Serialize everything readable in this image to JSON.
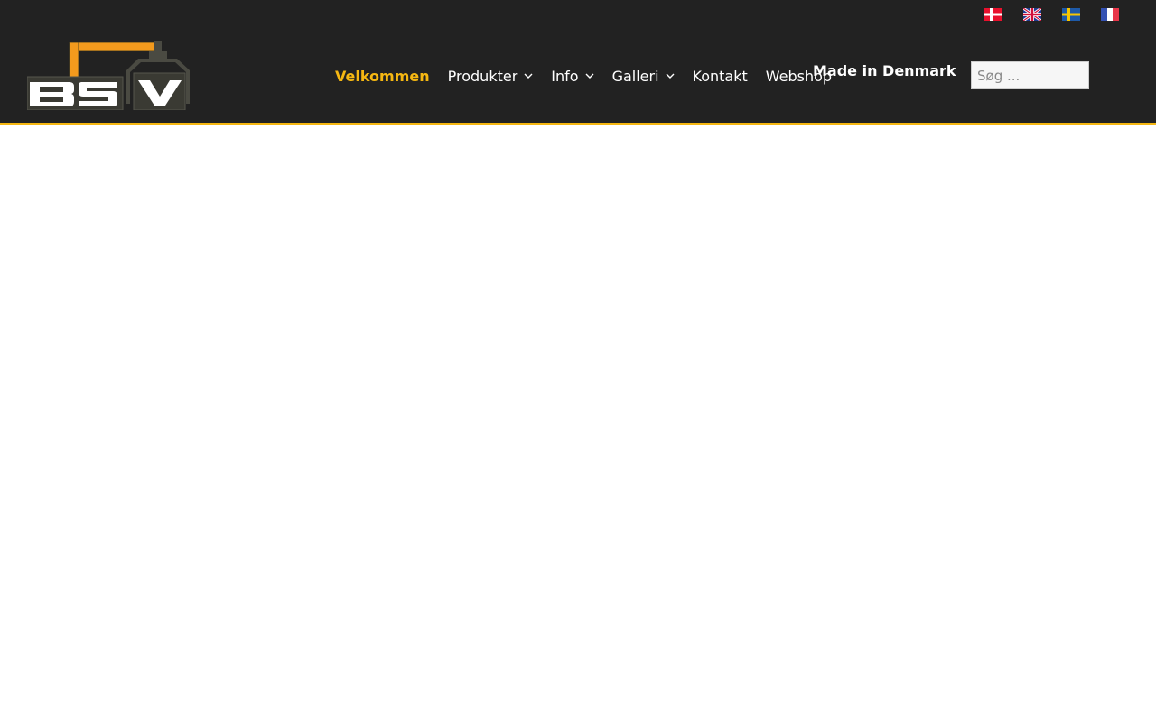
{
  "languages": [
    {
      "code": "da",
      "icon": "denmark-flag-icon"
    },
    {
      "code": "en",
      "icon": "uk-flag-icon"
    },
    {
      "code": "sv",
      "icon": "sweden-flag-icon"
    },
    {
      "code": "fr",
      "icon": "france-flag-icon"
    }
  ],
  "logo": {
    "text": "BSV"
  },
  "nav": {
    "items": [
      {
        "label": "Velkommen",
        "active": true
      },
      {
        "label": "Produkter",
        "dropdown": true
      },
      {
        "label": "Info",
        "dropdown": true
      },
      {
        "label": "Galleri",
        "dropdown": true
      },
      {
        "label": "Kontakt"
      },
      {
        "label": "Webshop"
      }
    ]
  },
  "tagline": "Made in Denmark",
  "search": {
    "placeholder": "Søg ...",
    "value": ""
  },
  "colors": {
    "header_bg": "#222222",
    "accent": "#f5b712",
    "logo_orange": "#f39a1d",
    "logo_dark": "#3a3a33"
  }
}
